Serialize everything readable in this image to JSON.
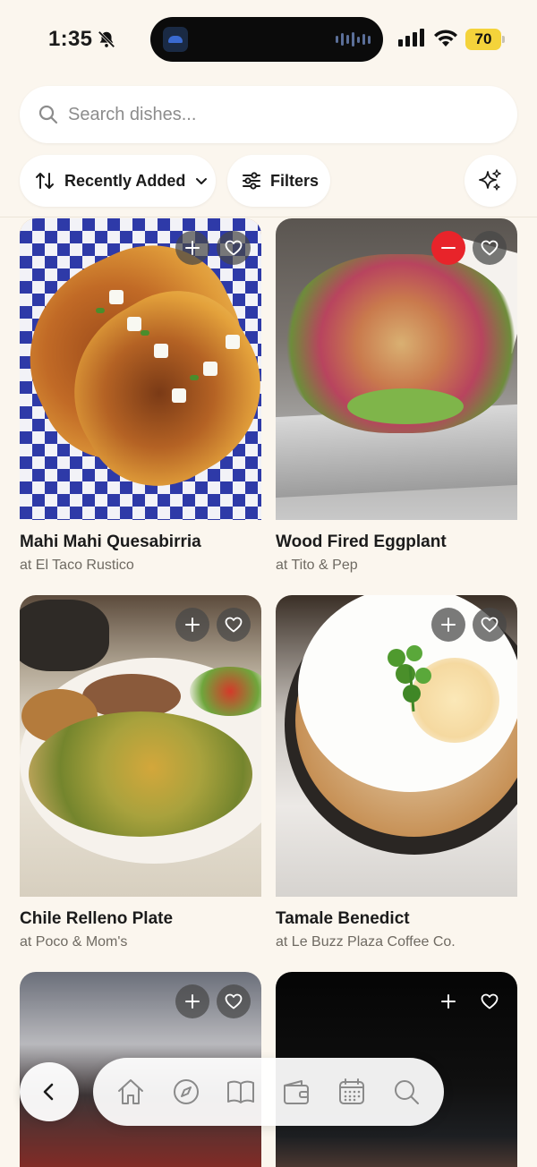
{
  "status_bar": {
    "time": "1:35",
    "battery_percent": "70",
    "battery_color": "#f4d33b"
  },
  "search": {
    "placeholder": "Search dishes..."
  },
  "controls": {
    "sort_label": "Recently Added",
    "filters_label": "Filters"
  },
  "dishes": [
    {
      "name": "Mahi Mahi Quesabirria",
      "restaurant": "at El Taco Rustico",
      "in_list": false
    },
    {
      "name": "Wood Fired Eggplant",
      "restaurant": "at Tito & Pep",
      "in_list": true
    },
    {
      "name": "Chile Relleno Plate",
      "restaurant": "at Poco & Mom's",
      "in_list": false
    },
    {
      "name": "Tamale Benedict",
      "restaurant": "at Le Buzz Plaza Coffee Co.",
      "in_list": false
    },
    {
      "name": "",
      "restaurant": "",
      "in_list": false
    },
    {
      "name": "",
      "restaurant": "",
      "in_list": false
    }
  ],
  "icons": {
    "remove": "minus-icon",
    "add": "plus-icon",
    "favorite": "heart-icon",
    "ai": "sparkles-icon"
  },
  "colors": {
    "background": "#fbf6ee",
    "remove_accent": "#e8242a"
  },
  "nav": [
    "back",
    "home",
    "explore",
    "book",
    "wallet",
    "calendar",
    "search"
  ]
}
